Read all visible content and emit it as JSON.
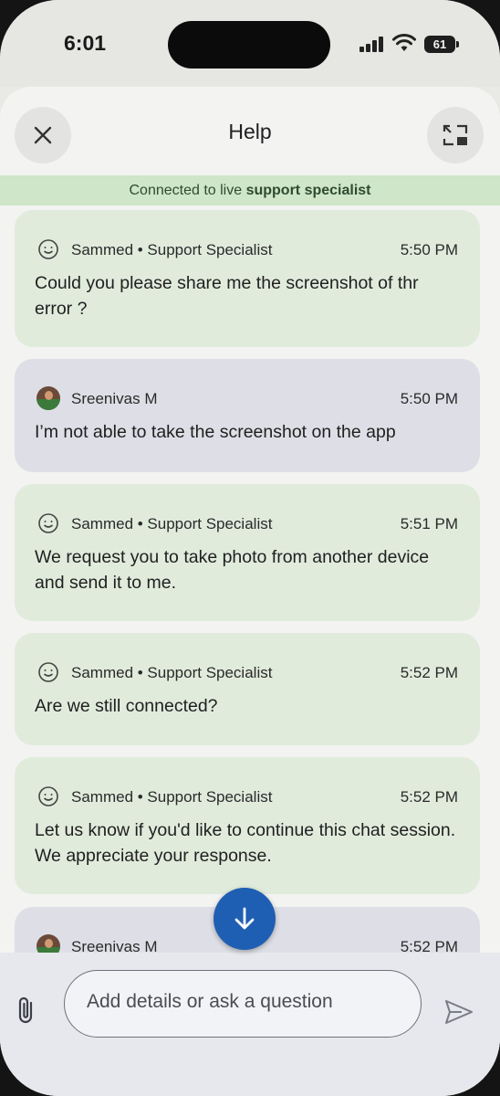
{
  "status_bar": {
    "time": "6:01",
    "battery": "61"
  },
  "header": {
    "title": "Help"
  },
  "banner": {
    "prefix": "Connected to live ",
    "bold": "support specialist"
  },
  "messages": [
    {
      "sender": "Sammed • Support Specialist",
      "time": "5:50 PM",
      "text": "Could you please share me the screenshot of thr error ?",
      "kind": "agent"
    },
    {
      "sender": "Sreenivas M",
      "time": "5:50 PM",
      "text": "I’m not able to take the screenshot on the app",
      "kind": "user"
    },
    {
      "sender": "Sammed • Support Specialist",
      "time": "5:51 PM",
      "text": "We request you to take photo from another device and send it to me.",
      "kind": "agent"
    },
    {
      "sender": "Sammed • Support Specialist",
      "time": "5:52 PM",
      "text": "Are we still connected?",
      "kind": "agent"
    },
    {
      "sender": "Sammed • Support Specialist",
      "time": "5:52 PM",
      "text": "Let us know if you'd like to continue this chat session. We appreciate your response.",
      "kind": "agent"
    },
    {
      "sender": "Sreenivas M",
      "time": "5:52 PM",
      "text": "",
      "kind": "user"
    }
  ],
  "composer": {
    "placeholder": "Add details or ask a question"
  },
  "icons": {
    "close": "close-icon",
    "expand": "expand-icon",
    "agent_avatar": "smiley-icon",
    "scroll": "arrow-down-icon",
    "attach": "paperclip-icon",
    "send": "send-icon"
  },
  "colors": {
    "banner": "#cfe6c9",
    "agent_bubble": "#e0ebdc",
    "user_bubble": "#dedfe6",
    "accent": "#1f5fb3"
  }
}
